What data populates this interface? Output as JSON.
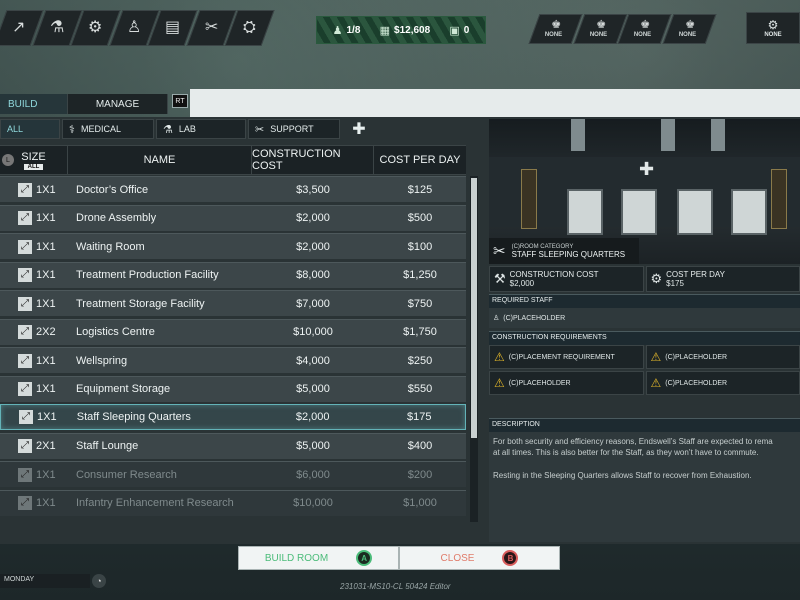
{
  "hud": {
    "toolbar_icons": [
      "arrow-icon",
      "flask-icon",
      "robot-arm-icon",
      "person-icon",
      "clipboard-icon",
      "tools-icon",
      "gear-box-icon"
    ],
    "stats": {
      "population": "1/8",
      "money": "$12,608",
      "items": "0"
    },
    "staff_slots": [
      {
        "label": "NONE"
      },
      {
        "label": "NONE"
      },
      {
        "label": "NONE"
      },
      {
        "label": "NONE"
      }
    ],
    "settings_label": "NONE"
  },
  "mode_tabs": {
    "build": "BUILD",
    "manage": "MANAGE",
    "rt": "RT"
  },
  "category_tabs": {
    "all": "ALL",
    "medical": "MEDICAL",
    "lab": "LAB",
    "support": "SUPPORT"
  },
  "table": {
    "headers": {
      "size": "SIZE",
      "size_filter": "ALL",
      "size_lb": "L",
      "name": "NAME",
      "construction_cost": "CONSTRUCTION COST",
      "cost_per_day": "COST PER DAY"
    },
    "rows": [
      {
        "size": "1X1",
        "name": "Doctor’s Office",
        "cost": "$3,500",
        "day": "$125",
        "state": "normal"
      },
      {
        "size": "1X1",
        "name": "Drone Assembly",
        "cost": "$2,000",
        "day": "$500",
        "state": "normal"
      },
      {
        "size": "1X1",
        "name": "Waiting Room",
        "cost": "$2,000",
        "day": "$100",
        "state": "normal"
      },
      {
        "size": "1X1",
        "name": "Treatment Production Facility",
        "cost": "$8,000",
        "day": "$1,250",
        "state": "normal"
      },
      {
        "size": "1X1",
        "name": "Treatment Storage Facility",
        "cost": "$7,000",
        "day": "$750",
        "state": "normal"
      },
      {
        "size": "2X2",
        "name": "Logistics Centre",
        "cost": "$10,000",
        "day": "$1,750",
        "state": "normal"
      },
      {
        "size": "1X1",
        "name": "Wellspring",
        "cost": "$4,000",
        "day": "$250",
        "state": "normal"
      },
      {
        "size": "1X1",
        "name": "Equipment Storage",
        "cost": "$5,000",
        "day": "$550",
        "state": "normal"
      },
      {
        "size": "1X1",
        "name": "Staff Sleeping Quarters",
        "cost": "$2,000",
        "day": "$175",
        "state": "selected"
      },
      {
        "size": "2X1",
        "name": "Staff Lounge",
        "cost": "$5,000",
        "day": "$400",
        "state": "normal"
      },
      {
        "size": "1X1",
        "name": "Consumer Research",
        "cost": "$6,000",
        "day": "$200",
        "state": "locked"
      },
      {
        "size": "1X1",
        "name": "Infantry Enhancement Research",
        "cost": "$10,000",
        "day": "$1,000",
        "state": "locked"
      }
    ]
  },
  "detail": {
    "room_category_label": "(C)ROOM CATEGORY",
    "room_name": "STAFF SLEEPING QUARTERS",
    "construction_cost_label": "CONSTRUCTION COST",
    "construction_cost_value": "$2,000",
    "cost_per_day_label": "COST PER DAY",
    "cost_per_day_value": "$175",
    "required_staff_title": "REQUIRED STAFF",
    "required_staff_value": "(C)PLACEHOLDER",
    "construction_req_title": "CONSTRUCTION REQUIREMENTS",
    "requirements": [
      "(C)PLACEMENT REQUIREMENT",
      "(C)PLACEHOLDER",
      "(C)PLACEHOLDER",
      "(C)PLACEHOLDER"
    ],
    "description_title": "DESCRIPTION",
    "description_p1_l1": "For both security and efficiency reasons, Endswell’s Staff are expected to rema",
    "description_p1_l2": "at all times. This is also better for the Staff, as they won’t have to commute.",
    "description_p2": "Resting in the Sleeping Quarters allows Staff to recover from Exhaustion."
  },
  "bottom": {
    "build_room": "BUILD ROOM",
    "build_key": "A",
    "close": "CLOSE",
    "close_key": "B",
    "day": "MONDAY",
    "version": "231031-MS10-CL 50424 Editor"
  },
  "colors": {
    "accent": "#8fd8dc",
    "build": "#4cbc7a",
    "close": "#e07b6a",
    "warning": "#e3b72a"
  }
}
